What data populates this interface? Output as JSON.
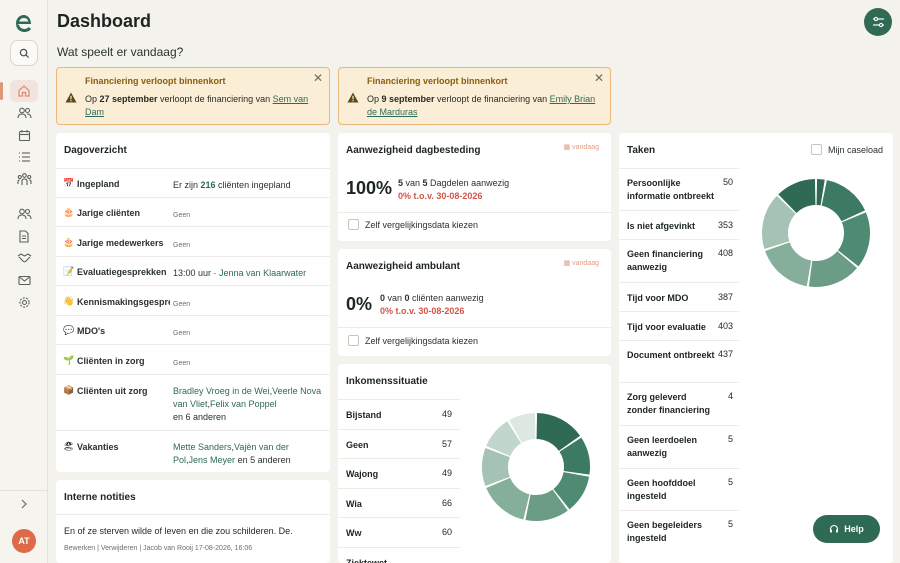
{
  "page": {
    "title": "Dashboard",
    "subtitle": "Wat speelt er vandaag?"
  },
  "sidebar": {
    "avatar_initials": "AT",
    "nav_icons": [
      "home-icon",
      "clients-icon",
      "calendar-icon",
      "list-icon",
      "group-icon",
      "team-icon",
      "document-icon",
      "handshake-icon",
      "mail-icon",
      "settings-icon"
    ]
  },
  "alerts": [
    {
      "title": "Financiering verloopt binnenkort",
      "prefix": "Op ",
      "date": "27 september",
      "middle": " verloopt de financiering van ",
      "client": "Sem van Dam"
    },
    {
      "title": "Financiering verloopt binnenkort",
      "prefix": "Op ",
      "date": "9 september",
      "middle": " verloopt de financiering van ",
      "client": "Emily Brian de Marduras"
    }
  ],
  "dagoverzicht": {
    "title": "Dagoverzicht",
    "rows": [
      {
        "icon": "📅",
        "label": "Ingepland",
        "pre": "Er zijn ",
        "count": "216",
        "post": " cliënten ingepland"
      },
      {
        "icon": "🎂",
        "label": "Jarige cliënten",
        "value": "Geen"
      },
      {
        "icon": "🎂",
        "label": "Jarige medewerkers",
        "value": "Geen"
      },
      {
        "icon": "📝",
        "label": "Evaluatiegesprekken",
        "time": "13:00 uur · ",
        "person": "Jenna van Klaarwater"
      },
      {
        "icon": "👋",
        "label": "Kennismakingsgesprekken",
        "value": "Geen"
      },
      {
        "icon": "💬",
        "label": "MDO's",
        "value": "Geen"
      },
      {
        "icon": "🌱",
        "label": "Cliënten in zorg",
        "value": "Geen"
      },
      {
        "icon": "📦",
        "label": "Cliënten uit zorg",
        "links": [
          "Bradley Vroeg in de Wei",
          "Veerle Nova van Vliet",
          "Felix van Poppel"
        ],
        "more": "en 6 anderen"
      },
      {
        "icon": "🏖",
        "label": "Vakanties",
        "links": [
          "Mette Sanders",
          "Vajèn van der Pol",
          "Jens Meyer"
        ],
        "more": "en 5 anderen"
      }
    ]
  },
  "dagbesteding": {
    "title": "Aanwezigheid dagbesteding",
    "badge": "vandaag",
    "percentage": "100%",
    "count": "5",
    "of_label": " van ",
    "total": "5",
    "suffix": " Dagdelen aanwezig",
    "compare": "0% t.o.v. 30-08-2026",
    "checkbox_label": "Zelf vergelijkingsdata kiezen"
  },
  "ambulant": {
    "title": "Aanwezigheid ambulant",
    "badge": "vandaag",
    "percentage": "0%",
    "count": "0",
    "of_label": " van ",
    "total": "0",
    "suffix": " cliënten aanwezig",
    "compare": "0% t.o.v. 30-08-2026",
    "checkbox_label": "Zelf vergelijkingsdata kiezen"
  },
  "inkomen": {
    "title": "Inkomenssituatie",
    "rows": [
      {
        "label": "Bijstand",
        "value": 49
      },
      {
        "label": "Geen",
        "value": 57
      },
      {
        "label": "Wajong",
        "value": 49
      },
      {
        "label": "Wia",
        "value": 66
      },
      {
        "label": "Ww",
        "value": 60
      },
      {
        "label": "Ziektewet",
        "value": ""
      }
    ],
    "colors": [
      "#2f6a55",
      "#3d7a63",
      "#4f8a72",
      "#6a9c86",
      "#85ae9b",
      "#a4c3b4",
      "#c2d7cc",
      "#dde8e2"
    ],
    "segments": [
      18,
      14,
      14,
      16,
      18,
      14,
      12,
      10
    ]
  },
  "taken": {
    "title": "Taken",
    "caseload_label": "Mijn caseload",
    "rows": [
      {
        "label": "Persoonlijke informatie ontbreekt",
        "value": 50
      },
      {
        "label": "Is niet afgevinkt",
        "value": 353
      },
      {
        "label": "Geen financiering aanwezig",
        "value": 408
      },
      {
        "label": "Tijd voor MDO",
        "value": 387
      },
      {
        "label": "Tijd voor evaluatie",
        "value": 403
      },
      {
        "label": "Document ontbreekt",
        "value": 437
      },
      {
        "label": "Zorg geleverd zonder financiering",
        "value": 4
      },
      {
        "label": "Geen leerdoelen aanwezig",
        "value": 5
      },
      {
        "label": "Geen hoofddoel ingesteld",
        "value": 5
      },
      {
        "label": "Geen begeleiders ingesteld",
        "value": 5
      }
    ],
    "colors": [
      "#2f6a55",
      "#3d7a63",
      "#4f8a72",
      "#6a9c86",
      "#85ae9b",
      "#a4c3b4"
    ],
    "segments": [
      3,
      16,
      18,
      17,
      18,
      18,
      13
    ]
  },
  "notities": {
    "title": "Interne notities",
    "text": "En of ze sterven wilde of leven en die zou schilderen. De.",
    "edit": "Bewerken",
    "delete": "Verwijderen",
    "author": "Jacob van Rooij",
    "date": "17-08-2026, 16:06"
  },
  "help": {
    "label": "Help"
  }
}
